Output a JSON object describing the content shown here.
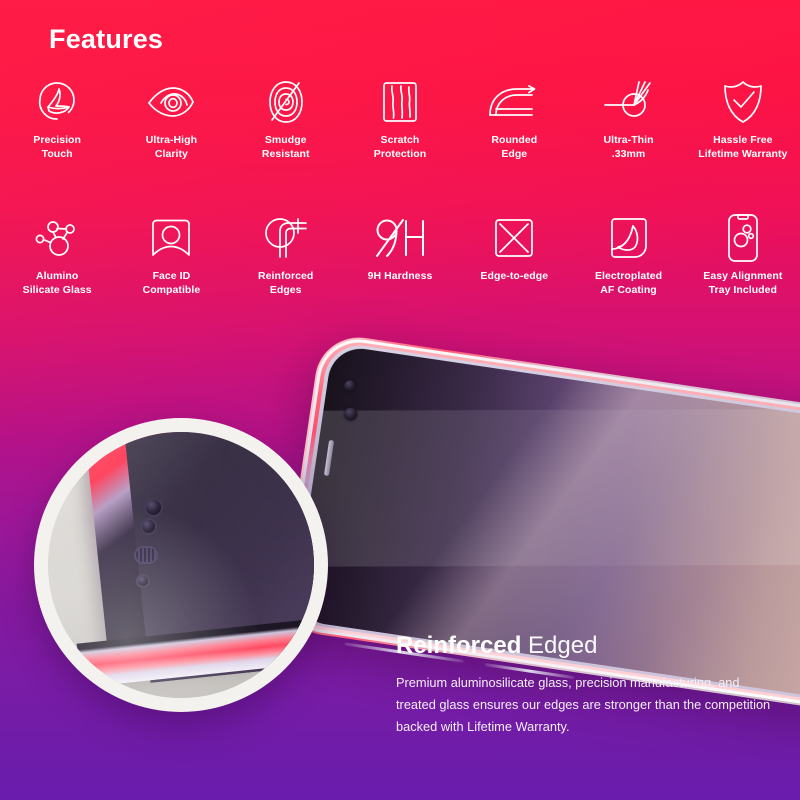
{
  "heading": "Features",
  "colors": {
    "gradient_top": "#ff0f40",
    "gradient_mid": "#b41289",
    "gradient_bottom": "#6a1cad",
    "text": "#ffffff",
    "edge_glow": "#ff4a63",
    "magnifier_ring": "#f4f2ef"
  },
  "features": {
    "row1": [
      {
        "icon": "precision-touch-icon",
        "label": "Precision\nTouch"
      },
      {
        "icon": "eye-clarity-icon",
        "label": "Ultra-High\nClarity"
      },
      {
        "icon": "smudge-resistant-icon",
        "label": "Smudge\nResistant"
      },
      {
        "icon": "scratch-protection-icon",
        "label": "Scratch\nProtection"
      },
      {
        "icon": "rounded-edge-icon",
        "label": "Rounded\nEdge"
      },
      {
        "icon": "ultra-thin-icon",
        "label": "Ultra-Thin\n.33mm"
      },
      {
        "icon": "shield-check-icon",
        "label": "Hassle Free\nLifetime Warranty"
      }
    ],
    "row2": [
      {
        "icon": "molecule-icon",
        "label": "Alumino\nSilicate Glass"
      },
      {
        "icon": "face-id-icon",
        "label": "Face ID\nCompatible"
      },
      {
        "icon": "reinforced-edges-icon",
        "label": "Reinforced\nEdges"
      },
      {
        "icon": "9h-hardness-icon",
        "label": "9H Hardness"
      },
      {
        "icon": "edge-to-edge-icon",
        "label": "Edge-to-edge"
      },
      {
        "icon": "af-coating-icon",
        "label": "Electroplated\nAF Coating"
      },
      {
        "icon": "alignment-tray-icon",
        "label": "Easy Alignment\nTray Included"
      }
    ]
  },
  "caption": {
    "title_strong": "Reinforced",
    "title_light": "Edged",
    "body": "Premium aluminosilicate glass, precision manufacturing, and treated glass ensures our edges are stronger than the competition backed with Lifetime Warranty."
  },
  "illustration": {
    "phone": "phone-edge-illustration",
    "magnifier": "magnifier-lens-closeup"
  }
}
